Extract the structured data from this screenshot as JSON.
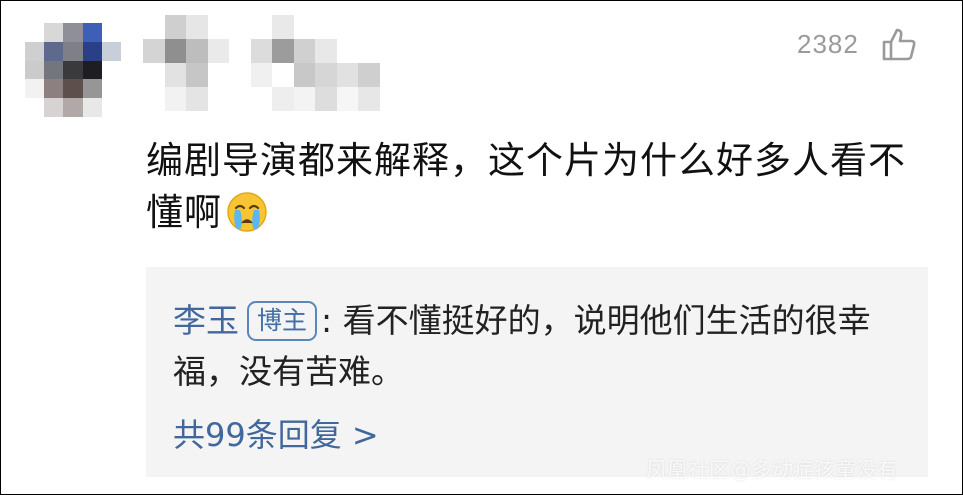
{
  "comment": {
    "like_count": "2382",
    "like_icon": "thumbs-up-icon",
    "text": "编剧导演都来解释，这个片为什么好多人看不懂啊",
    "emoji": "crying-face-emoji"
  },
  "reply": {
    "author": "李玉",
    "badge": "博主",
    "separator": ":",
    "text": "看不懂挺好的，说明他们生活的很幸福，没有苦难。",
    "more_replies": "共99条回复 >"
  },
  "watermark": "凤凰社区@多动症孩童没有",
  "colors": {
    "link": "#41689d",
    "reply_background": "#f4f4f4",
    "secondary_text": "#9a9a9a"
  }
}
